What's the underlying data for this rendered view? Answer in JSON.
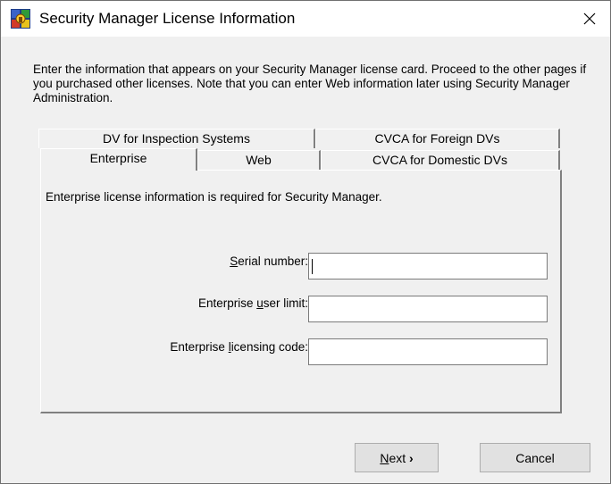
{
  "window": {
    "title": "Security Manager License Information",
    "close_glyph": "✕"
  },
  "intro": {
    "text": "Enter the information that appears on your Security Manager license card. Proceed to the other pages if you purchased other licenses. Note that you can enter Web information later using Security Manager Administration."
  },
  "tabs": {
    "back_row": [
      {
        "label": "DV for Inspection Systems"
      },
      {
        "label": "CVCA for Foreign DVs"
      }
    ],
    "front_row": [
      {
        "label": "Enterprise",
        "active": true
      },
      {
        "label": "Web",
        "active": false
      },
      {
        "label": "CVCA for Domestic DVs",
        "active": false
      }
    ]
  },
  "panel": {
    "description": "Enterprise license information is required for Security Manager.",
    "fields": [
      {
        "label_pre": "",
        "label_accel": "S",
        "label_post": "erial number:",
        "value": ""
      },
      {
        "label_pre": "Enterprise ",
        "label_accel": "u",
        "label_post": "ser limit:",
        "value": ""
      },
      {
        "label_pre": "Enterprise ",
        "label_accel": "l",
        "label_post": "icensing code:",
        "value": ""
      }
    ]
  },
  "buttons": {
    "next_accel": "N",
    "next_rest": "ext",
    "next_arrow": "›",
    "cancel": "Cancel"
  },
  "icons": {
    "app": "security-manager-app-icon",
    "close": "close-icon"
  }
}
